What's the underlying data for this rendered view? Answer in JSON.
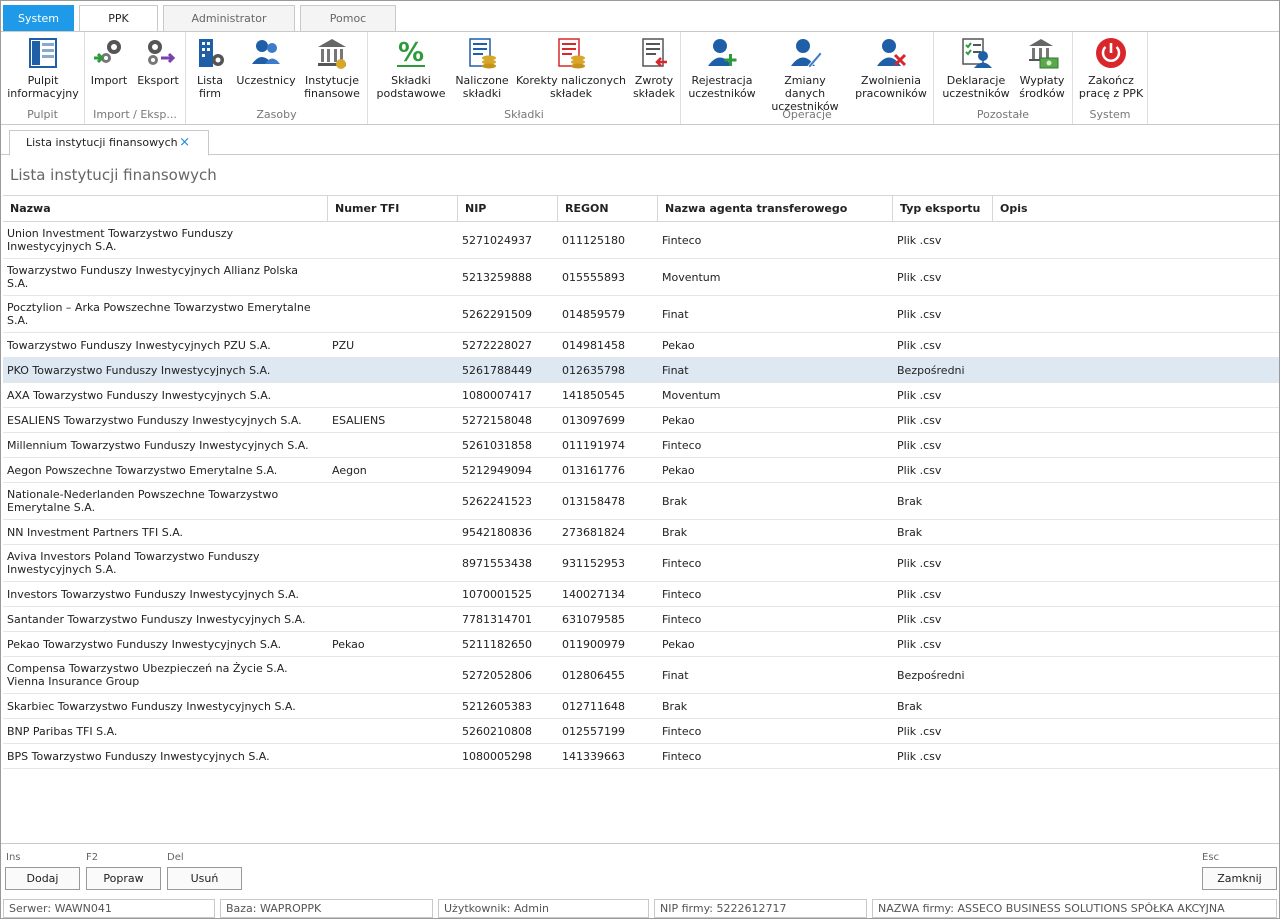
{
  "menu_tabs": {
    "system": "System",
    "ppk": "PPK",
    "admin": "Administrator",
    "pomoc": "Pomoc"
  },
  "ribbon": {
    "groups": {
      "pulpit": "Pulpit",
      "import": "Import / Eksp...",
      "zasoby": "Zasoby",
      "skladki": "Składki",
      "operacje": "Operacje",
      "pozostale": "Pozostałe",
      "system": "System"
    },
    "buttons": {
      "pulpit": "Pulpit\ninformacyjny",
      "import": "Import",
      "eksport": "Eksport",
      "lista_firm": "Lista\nfirm",
      "uczestnicy": "Uczestnicy",
      "instytucje": "Instytucje\nfinansowe",
      "skladki_podst": "Składki\npodstawowe",
      "naliczone": "Naliczone\nskładki",
      "korekty": "Korekty naliczonych\nskładek",
      "zwroty": "Zwroty\nskładek",
      "rejestracja": "Rejestracja\nuczestników",
      "zmiany": "Zmiany danych\nuczestników",
      "zwolnienia": "Zwolnienia\npracowników",
      "deklaracje": "Deklaracje\nuczestników",
      "wyplaty": "Wypłaty\nśrodków",
      "zakoncz": "Zakończ\npracę z PPK"
    }
  },
  "doc_tab": {
    "label": "Lista instytucji finansowych",
    "close": "×"
  },
  "page_title": "Lista instytucji finansowych",
  "table": {
    "columns": [
      "Nazwa",
      "Numer TFI",
      "NIP",
      "REGON",
      "Nazwa agenta transferowego",
      "Typ eksportu",
      "Opis"
    ],
    "rows": [
      [
        "Union Investment Towarzystwo Funduszy Inwestycyjnych S.A.",
        "",
        "5271024937",
        "011125180",
        "Finteco",
        "Plik .csv",
        ""
      ],
      [
        "Towarzystwo Funduszy Inwestycyjnych Allianz Polska S.A.",
        "",
        "5213259888",
        "015555893",
        "Moventum",
        "Plik .csv",
        ""
      ],
      [
        "Pocztylion – Arka Powszechne Towarzystwo Emerytalne S.A.",
        "",
        "5262291509",
        "014859579",
        "Finat",
        "Plik .csv",
        ""
      ],
      [
        "Towarzystwo Funduszy Inwestycyjnych PZU S.A.",
        "PZU",
        "5272228027",
        "014981458",
        "Pekao",
        "Plik .csv",
        ""
      ],
      [
        "PKO Towarzystwo Funduszy Inwestycyjnych S.A.",
        "",
        "5261788449",
        "012635798",
        "Finat",
        "Bezpośredni",
        ""
      ],
      [
        "AXA Towarzystwo Funduszy Inwestycyjnych S.A.",
        "",
        "1080007417",
        "141850545",
        "Moventum",
        "Plik .csv",
        ""
      ],
      [
        "ESALIENS Towarzystwo Funduszy Inwestycyjnych S.A.",
        "ESALIENS",
        "5272158048",
        "013097699",
        "Pekao",
        "Plik .csv",
        ""
      ],
      [
        "Millennium Towarzystwo Funduszy Inwestycyjnych S.A.",
        "",
        "5261031858",
        "011191974",
        "Finteco",
        "Plik .csv",
        ""
      ],
      [
        "Aegon Powszechne Towarzystwo Emerytalne S.A.",
        "Aegon",
        "5212949094",
        "013161776",
        "Pekao",
        "Plik .csv",
        ""
      ],
      [
        "Nationale-Nederlanden Powszechne Towarzystwo Emerytalne S.A.",
        "",
        "5262241523",
        "013158478",
        "Brak",
        "Brak",
        ""
      ],
      [
        "NN Investment Partners TFI S.A.",
        "",
        "9542180836",
        "273681824",
        "Brak",
        "Brak",
        ""
      ],
      [
        "Aviva Investors Poland Towarzystwo Funduszy Inwestycyjnych S.A.",
        "",
        "8971553438",
        "931152953",
        "Finteco",
        "Plik .csv",
        ""
      ],
      [
        "Investors Towarzystwo Funduszy Inwestycyjnych S.A.",
        "",
        "1070001525",
        "140027134",
        "Finteco",
        "Plik .csv",
        ""
      ],
      [
        "Santander Towarzystwo Funduszy Inwestycyjnych S.A.",
        "",
        "7781314701",
        "631079585",
        "Finteco",
        "Plik .csv",
        ""
      ],
      [
        "Pekao Towarzystwo Funduszy Inwestycyjnych S.A.",
        "Pekao",
        "5211182650",
        "011900979",
        "Pekao",
        "Plik .csv",
        ""
      ],
      [
        "Compensa Towarzystwo Ubezpieczeń na Życie S.A. Vienna Insurance Group",
        "",
        "5272052806",
        "012806455",
        "Finat",
        "Bezpośredni",
        ""
      ],
      [
        "Skarbiec Towarzystwo Funduszy Inwestycyjnych S.A.",
        "",
        "5212605383",
        "012711648",
        "Brak",
        "Brak",
        ""
      ],
      [
        "BNP Paribas TFI S.A.",
        "",
        "5260210808",
        "012557199",
        "Finteco",
        "Plik .csv",
        ""
      ],
      [
        "BPS Towarzystwo Funduszy Inwestycyjnych S.A.",
        "",
        "1080005298",
        "141339663",
        "Finteco",
        "Plik .csv",
        ""
      ]
    ],
    "selected_row": 4
  },
  "bottom": {
    "keys": {
      "ins": "Ins",
      "f2": "F2",
      "del": "Del",
      "esc": "Esc"
    },
    "buttons": {
      "dodaj": "Dodaj",
      "popraw": "Popraw",
      "usun": "Usuń",
      "zamknij": "Zamknij"
    }
  },
  "status": {
    "serwer": "Serwer: WAWN041",
    "baza": "Baza: WAPROPPK",
    "uzytkownik": "Użytkownik: Admin",
    "nip": "NIP firmy: 5222612717",
    "nazwa": "NAZWA firmy: ASSECO BUSINESS SOLUTIONS SPÓŁKA AKCYJNA"
  },
  "colors": {
    "accent": "#1e9ae8",
    "selected_row": "#dde8f3",
    "icon_blue": "#1f5fa8",
    "icon_green": "#2e9a3c",
    "icon_red": "#d9262b"
  }
}
